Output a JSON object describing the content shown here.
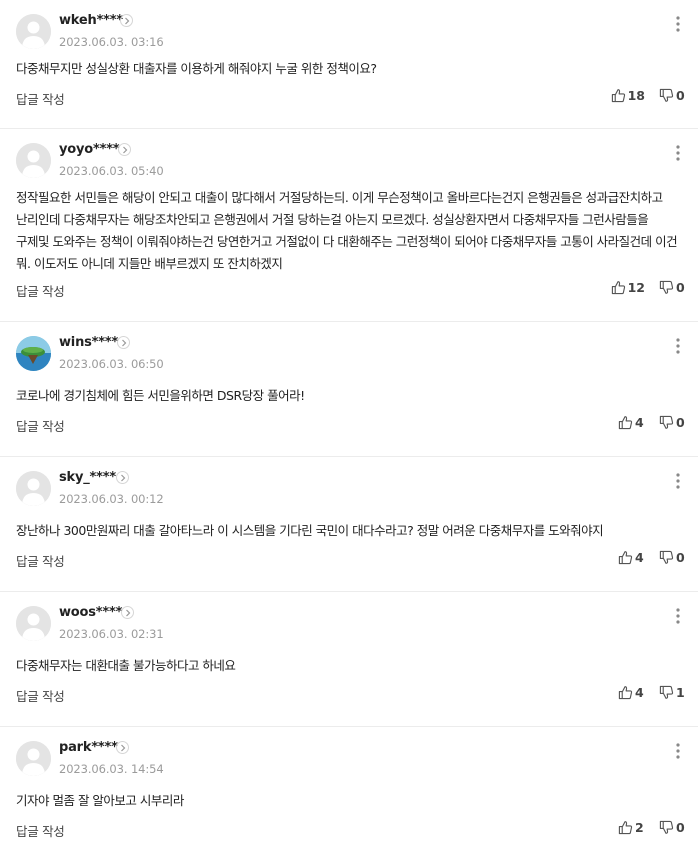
{
  "reply_label": "답글 작성",
  "comments": [
    {
      "username": "wkeh****",
      "date": "2023.06.03. 03:16",
      "text": "다중채무지만 성실상환 대출자를 이용하게 해줘야지 누굴 위한 정책이요?",
      "likes": "18",
      "dislikes": "0"
    },
    {
      "username": "yoyo****",
      "date": "2023.06.03. 05:40",
      "text": "정작필요한 서민들은 해당이 안되고 대출이 많다해서 거절당하는듸. 이게 무슨정책이고 올바르다는건지 은행권들은 성과급잔치하고 난리인데 다중채무자는 해당조차안되고 은행권에서 거절 당하는걸 아는지 모르겠다. 성실상환자면서 다중채무자들 그런사람들을 구제및 도와주는 정책이 이뤄줘야하는건 당연한거고 거절없이 다 대환해주는 그런정책이 되어야 다중채무자들 고통이 사라질건데 이건 뭐. 이도저도 아니데 지들만 배부르겠지 또 잔치하겠지",
      "likes": "12",
      "dislikes": "0"
    },
    {
      "username": "wins****",
      "date": "2023.06.03. 06:50",
      "text": "코로나에 경기침체에 힘든 서민을위하면 DSR당장 풀어라!",
      "likes": "4",
      "dislikes": "0"
    },
    {
      "username": "sky_****",
      "date": "2023.06.03. 00:12",
      "text": "장난하나 300만원짜리 대출 갈아타느라 이 시스템을 기다린 국민이 대다수라고? 정말 어려운 다중채무자를 도와줘야지",
      "likes": "4",
      "dislikes": "0"
    },
    {
      "username": "woos****",
      "date": "2023.06.03. 02:31",
      "text": "다중채무자는 대환대출 불가능하다고 하네요",
      "likes": "4",
      "dislikes": "1"
    },
    {
      "username": "park****",
      "date": "2023.06.03. 14:54",
      "text": "기자야 멀좀 잘 알아보고 시부리라",
      "likes": "2",
      "dislikes": "0"
    }
  ]
}
